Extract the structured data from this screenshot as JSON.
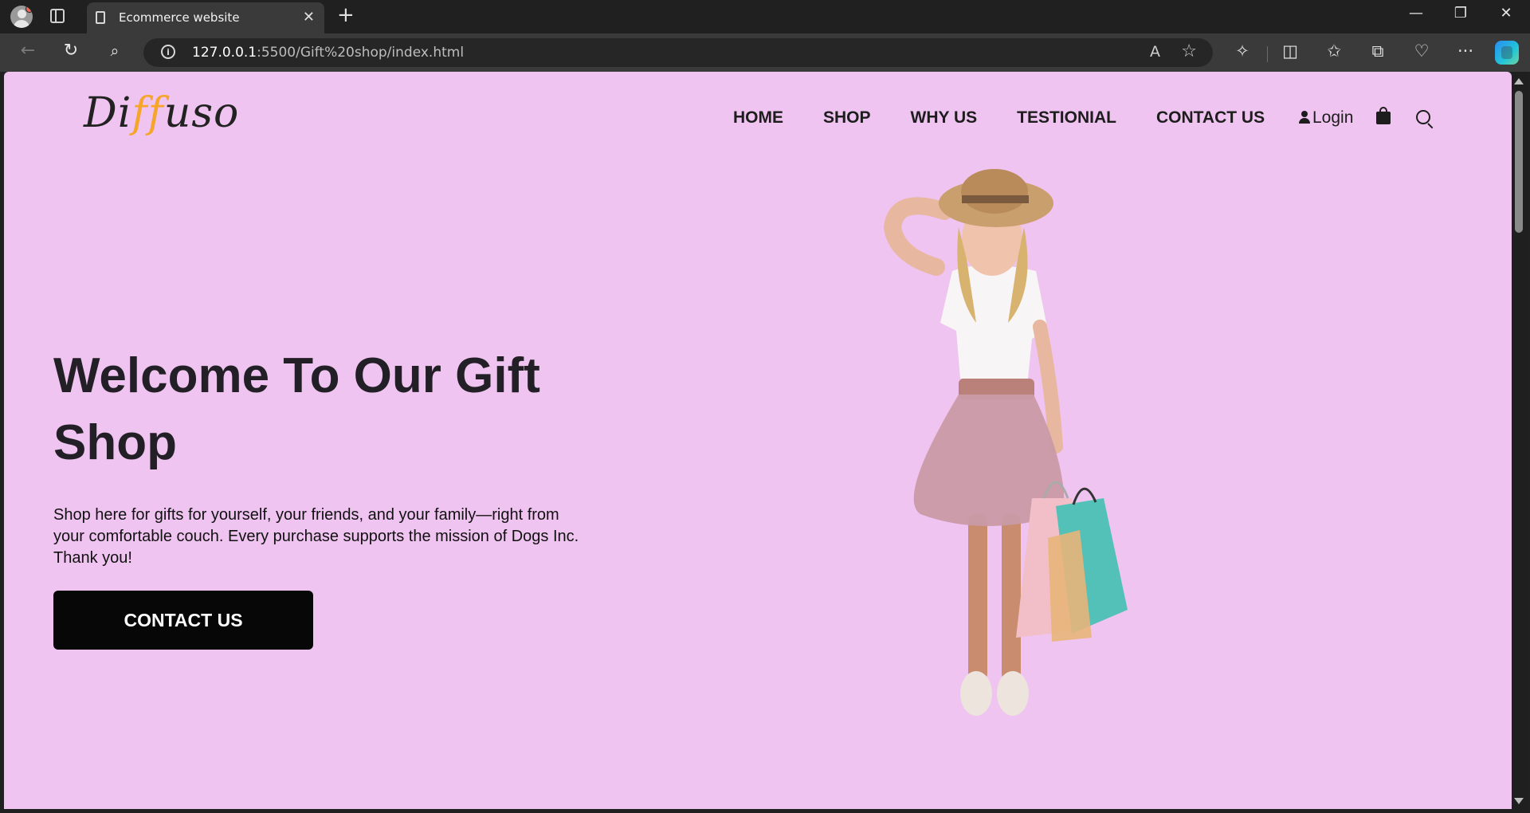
{
  "browser": {
    "tab_title": "Ecommerce website",
    "url_host": "127.0.0.1",
    "url_rest": ":5500/Gift%20shop/index.html"
  },
  "site": {
    "logo": {
      "part1": "Di",
      "accent": "ff",
      "part2": "uso",
      "accent_color": "#f4a52a"
    },
    "nav": [
      "HOME",
      "SHOP",
      "WHY US",
      "TESTIONIAL",
      "CONTACT US"
    ],
    "login": "Login",
    "hero": {
      "title": "Welcome To Our Gift Shop",
      "text": "Shop here for gifts for yourself, your friends, and your family—right from your comfortable couch. Every purchase supports the mission of Dogs Inc. Thank you!",
      "cta": "CONTACT US"
    },
    "colors": {
      "background": "#f0c4f0",
      "button": "#070707"
    }
  }
}
